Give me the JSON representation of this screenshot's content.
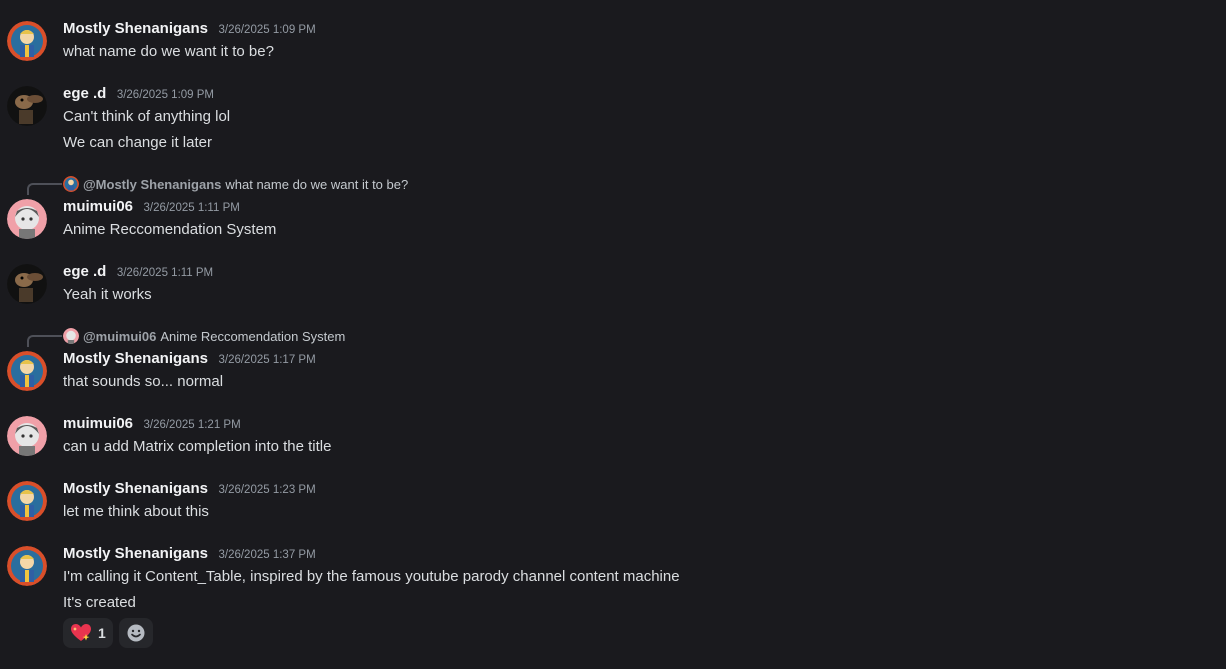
{
  "messages": [
    {
      "username": "Mostly Shenanigans",
      "timestamp": "3/26/2025 1:09 PM",
      "lines": [
        "what name do we want it to be?"
      ]
    },
    {
      "username": "ege .d",
      "timestamp": "3/26/2025 1:09 PM",
      "lines": [
        "Can't think of anything lol",
        "We can change it later"
      ]
    },
    {
      "reply": {
        "user": "@Mostly Shenanigans",
        "text": "what name do we want it to be?"
      },
      "username": "muimui06",
      "timestamp": "3/26/2025 1:11 PM",
      "lines": [
        "Anime Reccomendation System"
      ]
    },
    {
      "username": "ege .d",
      "timestamp": "3/26/2025 1:11 PM",
      "lines": [
        "Yeah it works"
      ]
    },
    {
      "reply": {
        "user": "@muimui06",
        "text": "Anime Reccomendation System"
      },
      "username": "Mostly Shenanigans",
      "timestamp": "3/26/2025 1:17 PM",
      "lines": [
        "that sounds so... normal"
      ]
    },
    {
      "username": "muimui06",
      "timestamp": "3/26/2025 1:21 PM",
      "lines": [
        "can u add Matrix completion into the title"
      ]
    },
    {
      "username": "Mostly Shenanigans",
      "timestamp": "3/26/2025 1:23 PM",
      "lines": [
        "let me think about this"
      ]
    },
    {
      "username": "Mostly Shenanigans",
      "timestamp": "3/26/2025 1:37 PM",
      "lines": [
        "I'm calling it Content_Table, inspired by the famous youtube parody channel content machine",
        "It's created"
      ],
      "reactions": [
        {
          "emoji": "sparkling-heart-icon",
          "count": "1"
        }
      ]
    }
  ],
  "icons": {
    "add_reaction": "smiley-add-icon",
    "avatar_mostly": "vault-boy-avatar",
    "avatar_ege": "dark-creature-avatar",
    "avatar_muimui": "anime-girl-avatar"
  }
}
